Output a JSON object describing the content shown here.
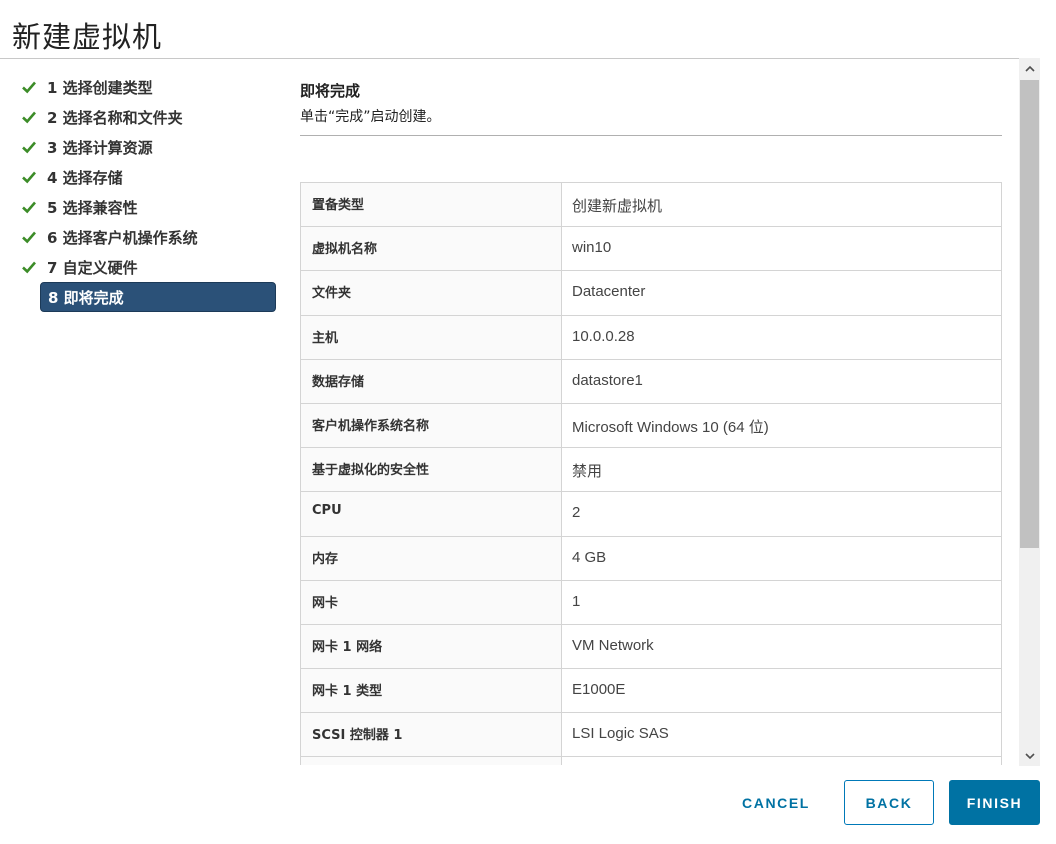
{
  "dialog": {
    "title": "新建虚拟机"
  },
  "steps": [
    {
      "label": "1 选择创建类型",
      "done": true
    },
    {
      "label": "2 选择名称和文件夹",
      "done": true
    },
    {
      "label": "3 选择计算资源",
      "done": true
    },
    {
      "label": "4 选择存储",
      "done": true
    },
    {
      "label": "5 选择兼容性",
      "done": true
    },
    {
      "label": "6 选择客户机操作系统",
      "done": true
    },
    {
      "label": "7 自定义硬件",
      "done": true
    },
    {
      "label": "8 即将完成",
      "done": false,
      "active": true
    }
  ],
  "content": {
    "title": "即将完成",
    "description": "单击“完成”启动创建。"
  },
  "summary": [
    {
      "key": "置备类型",
      "value": "创建新虚拟机"
    },
    {
      "key": "虚拟机名称",
      "value": "win10"
    },
    {
      "key": "文件夹",
      "value": "Datacenter"
    },
    {
      "key": "主机",
      "value": "10.0.0.28"
    },
    {
      "key": "数据存储",
      "value": "datastore1"
    },
    {
      "key": "客户机操作系统名称",
      "value": "Microsoft Windows 10 (64 位)"
    },
    {
      "key": "基于虚拟化的安全性",
      "value": "禁用"
    },
    {
      "key": "CPU",
      "value": "2"
    },
    {
      "key": "内存",
      "value": "4 GB"
    },
    {
      "key": "网卡",
      "value": "1"
    },
    {
      "key": "网卡 1 网络",
      "value": "VM Network"
    },
    {
      "key": "网卡 1 类型",
      "value": "E1000E"
    },
    {
      "key": "SCSI 控制器 1",
      "value": "LSI Logic SAS"
    },
    {
      "key": "",
      "value": ""
    }
  ],
  "buttons": {
    "cancel": "CANCEL",
    "back": "BACK",
    "finish": "FINISH"
  },
  "colors": {
    "check": "#3c8c28",
    "active_step": "#2b5178",
    "primary": "#0072a3"
  },
  "scroll": {
    "up_icon": "chevron-up-icon",
    "down_icon": "chevron-down-icon"
  }
}
